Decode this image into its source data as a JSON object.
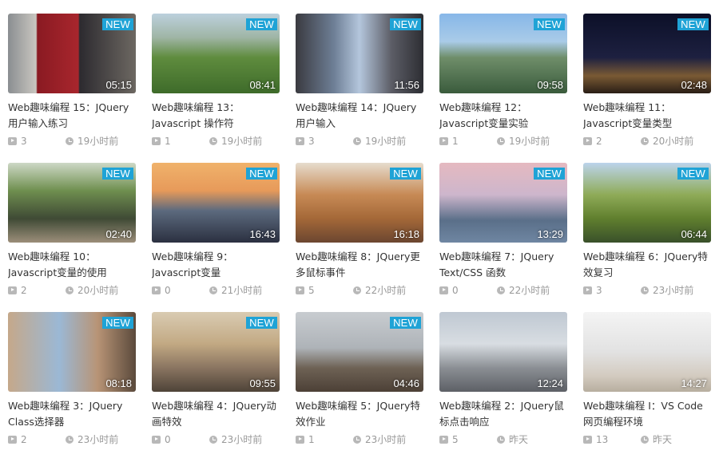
{
  "videos": [
    {
      "title": "Web趣味编程 15：JQuery用户输入练习",
      "duration": "05:15",
      "views": "3",
      "time": "19小时前",
      "is_new": true,
      "new_label": "NEW"
    },
    {
      "title": "Web趣味编程 13：Javascript 操作符",
      "duration": "08:41",
      "views": "1",
      "time": "19小时前",
      "is_new": true,
      "new_label": "NEW"
    },
    {
      "title": "Web趣味编程 14：JQuery用户输入",
      "duration": "11:56",
      "views": "3",
      "time": "19小时前",
      "is_new": true,
      "new_label": "NEW"
    },
    {
      "title": "Web趣味编程 12：Javascript变量实验",
      "duration": "09:58",
      "views": "1",
      "time": "19小时前",
      "is_new": true,
      "new_label": "NEW"
    },
    {
      "title": "Web趣味编程 11：Javascript变量类型",
      "duration": "02:48",
      "views": "2",
      "time": "20小时前",
      "is_new": true,
      "new_label": "NEW"
    },
    {
      "title": "Web趣味编程 10：Javascript变量的使用",
      "duration": "02:40",
      "views": "2",
      "time": "20小时前",
      "is_new": true,
      "new_label": "NEW"
    },
    {
      "title": "Web趣味编程 9：Javascript变量",
      "duration": "16:43",
      "views": "0",
      "time": "21小时前",
      "is_new": true,
      "new_label": "NEW"
    },
    {
      "title": "Web趣味编程 8：JQuery更多鼠标事件",
      "duration": "16:18",
      "views": "5",
      "time": "22小时前",
      "is_new": true,
      "new_label": "NEW"
    },
    {
      "title": "Web趣味编程 7：JQuery Text/CSS 函数",
      "duration": "13:29",
      "views": "0",
      "time": "22小时前",
      "is_new": true,
      "new_label": "NEW"
    },
    {
      "title": "Web趣味编程 6：JQuery特效复习",
      "duration": "06:44",
      "views": "3",
      "time": "23小时前",
      "is_new": true,
      "new_label": "NEW"
    },
    {
      "title": "Web趣味编程 3：JQuery Class选择器",
      "duration": "08:18",
      "views": "2",
      "time": "23小时前",
      "is_new": true,
      "new_label": "NEW"
    },
    {
      "title": "Web趣味编程 4：JQuery动画特效",
      "duration": "09:55",
      "views": "0",
      "time": "23小时前",
      "is_new": true,
      "new_label": "NEW"
    },
    {
      "title": "Web趣味编程 5：JQuery特效作业",
      "duration": "04:46",
      "views": "1",
      "time": "23小时前",
      "is_new": true,
      "new_label": "NEW"
    },
    {
      "title": "Web趣味编程 2：JQuery鼠标点击响应",
      "duration": "12:24",
      "views": "5",
      "time": "昨天",
      "is_new": false,
      "new_label": ""
    },
    {
      "title": "Web趣味编程 I：VS Code网页编程环境",
      "duration": "14:27",
      "views": "13",
      "time": "昨天",
      "is_new": false,
      "new_label": ""
    }
  ],
  "colors": {
    "new_badge": "#1fa3d6",
    "meta_text": "#999999",
    "title_text": "#333333"
  },
  "icons": {
    "views": "play-icon",
    "time": "clock-icon"
  }
}
